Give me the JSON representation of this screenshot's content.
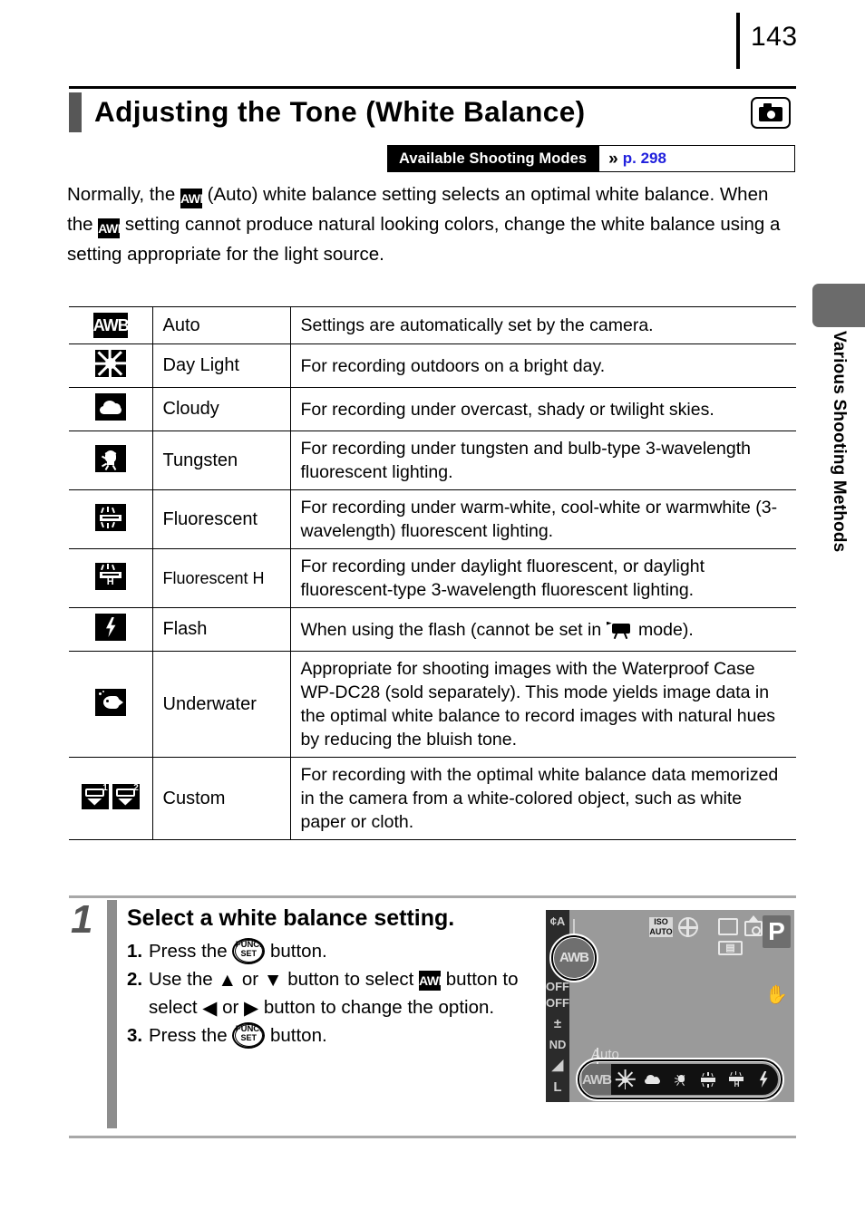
{
  "page": {
    "number": "143",
    "side_tab_label": "Various Shooting Methods"
  },
  "heading": {
    "title": "Adjusting the Tone (White Balance)",
    "mode_icon": "still-camera-icon"
  },
  "available_modes": {
    "label": "Available Shooting Modes",
    "chevron": "»",
    "page_link": "p. 298",
    "link_color": "#2121dd"
  },
  "intro": {
    "part1": "Normally, the ",
    "icon1": "awb-icon",
    "part2": " (Auto) white balance setting selects an optimal white balance. When the ",
    "icon2": "awb-icon",
    "part3": " setting cannot produce natural looking colors, change the white balance using a setting appropriate for the light source."
  },
  "table": {
    "rows": [
      {
        "icon": "awb-icon",
        "name": "Auto",
        "desc": "Settings are automatically set by the camera."
      },
      {
        "icon": "sun-icon",
        "name": "Day Light",
        "desc": "For recording outdoors on a bright day."
      },
      {
        "icon": "cloud-icon",
        "name": "Cloudy",
        "desc": "For recording under overcast, shady or twilight skies."
      },
      {
        "icon": "tungsten-bulb-icon",
        "name": "Tungsten",
        "desc": "For recording under tungsten and bulb-type 3-wavelength fluorescent lighting."
      },
      {
        "icon": "fluorescent-icon",
        "name": "Fluorescent",
        "desc": "For recording under warm-white, cool-white or warmwhite (3-wavelength) fluorescent lighting."
      },
      {
        "icon": "fluorescent-h-icon",
        "name": "Fluorescent H",
        "desc": "For recording under daylight fluorescent, or daylight fluorescent-type 3-wavelength fluorescent lighting."
      },
      {
        "icon": "flash-icon",
        "name": "Flash",
        "desc_before": "When using the flash (cannot be set in ",
        "desc_icon": "movie-mode-icon",
        "desc_after": " mode)."
      },
      {
        "icon": "underwater-fish-icon",
        "name": "Underwater",
        "desc": "Appropriate for shooting images with the Waterproof Case WP-DC28 (sold separately). This mode yields image data in the optimal white balance to record images with natural hues by reducing the bluish tone."
      },
      {
        "icon": "custom-wb-icon",
        "icon2": "custom-wb-2-icon",
        "name": "Custom",
        "desc": "For recording with the optimal white balance data memorized in the camera from a white-colored object, such as white paper or cloth."
      }
    ]
  },
  "step": {
    "number": "1",
    "title": "Select a white balance setting.",
    "items": [
      {
        "n": "1.",
        "before": "Press the ",
        "icon": "func-set-button-icon",
        "after": " button."
      },
      {
        "n": "2.",
        "seg1": "Use the ",
        "up": "▲",
        "seg2": " or ",
        "down": "▼",
        "seg3": " button to select ",
        "awb": "awb-icon",
        "seg4": "button to select ",
        "left": "◀",
        "seg5": " or ",
        "right": "▶",
        "seg6": " button to change the option."
      },
      {
        "n": "3.",
        "before": "Press the ",
        "icon": "func-set-button-icon",
        "after": " button."
      }
    ],
    "func_set": {
      "line1": "FUNC.",
      "line2": "SET"
    }
  },
  "lcd": {
    "mode_letter": "P",
    "iso_line1": "ISO",
    "iso_line2": "AUTO",
    "battery": "▤",
    "left_icons": [
      "flash-auto-icon",
      "awb-selected-icon",
      "drive-off-icon",
      "red-eye-off-icon",
      "exposure-comp-icon",
      "nd-filter-icon",
      "my-colors-icon",
      "resolution-L-icon"
    ],
    "left_labels": [
      "¢A",
      "AWB",
      "OFF",
      "OFF",
      "±",
      "ND",
      "",
      "L"
    ],
    "selected_wb_chip": "AWB",
    "option_label": "Auto",
    "wb_options": [
      "AWB",
      "sun-icon",
      "cloud-icon",
      "tungsten-bulb-icon",
      "fluorescent-icon",
      "fluorescent-h-icon",
      "flash-icon"
    ],
    "hand_icon": "shake-warning-hand-icon"
  }
}
